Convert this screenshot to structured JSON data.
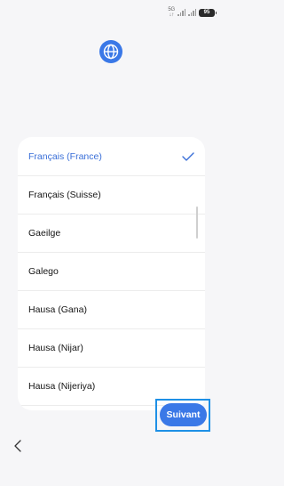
{
  "status_bar": {
    "network_top": "5G",
    "network_bottom": "↓↑",
    "battery_level": "95"
  },
  "header": {
    "icon": "globe-icon"
  },
  "language_list": {
    "items": [
      {
        "label": "Français (France)",
        "selected": true
      },
      {
        "label": "Français (Suisse)",
        "selected": false
      },
      {
        "label": "Gaeilge",
        "selected": false
      },
      {
        "label": "Galego",
        "selected": false
      },
      {
        "label": "Hausa (Gana)",
        "selected": false
      },
      {
        "label": "Hausa (Nijar)",
        "selected": false
      },
      {
        "label": "Hausa (Nijeriya)",
        "selected": false
      }
    ],
    "selected_color": "#3a6fd8"
  },
  "footer": {
    "next_label": "Suivant",
    "next_color": "#3a78e7",
    "highlight_color": "#1e90e6",
    "back_icon": "chevron-left-icon"
  }
}
